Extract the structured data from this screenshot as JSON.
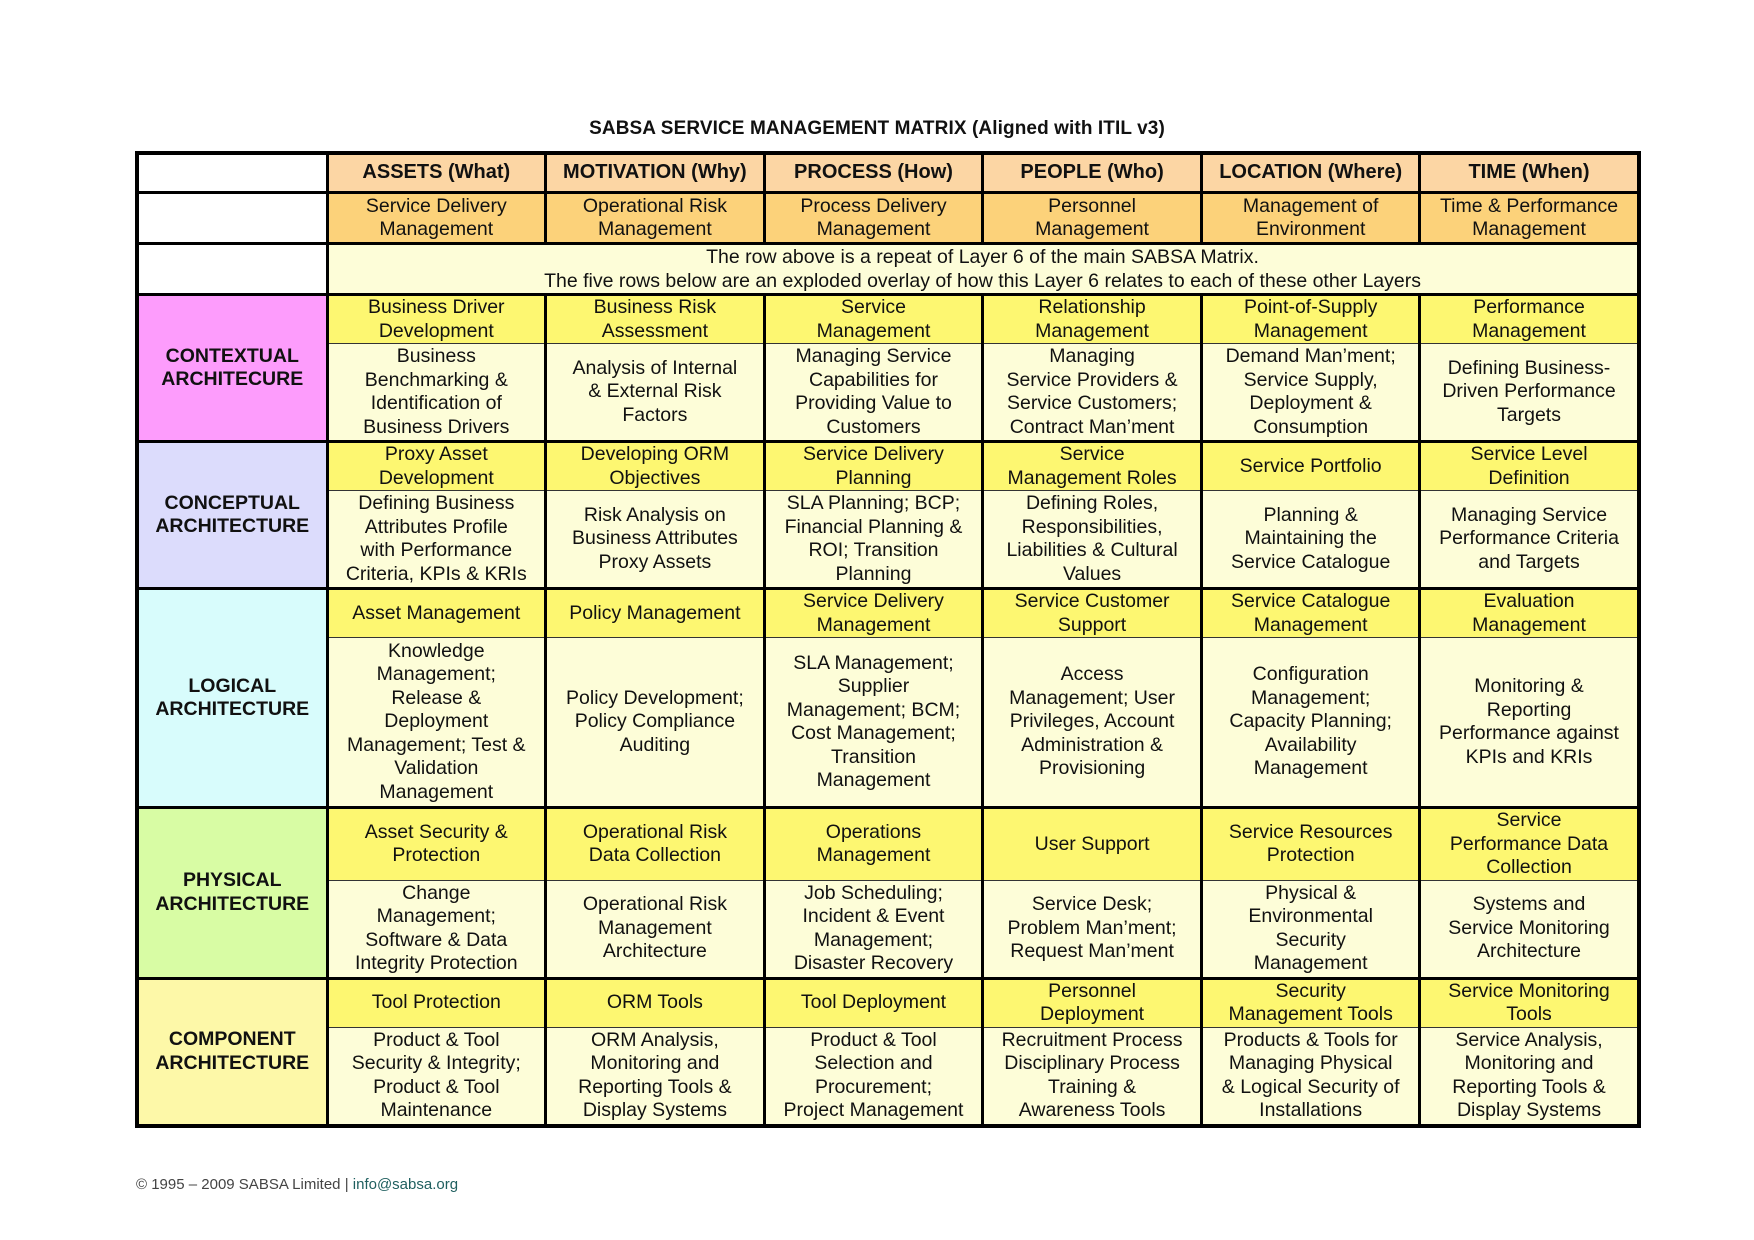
{
  "title": "SABSA SERVICE MANAGEMENT MATRIX (Aligned with ITIL v3)",
  "columns": [
    {
      "header": "ASSETS (What)",
      "layer6": [
        "Service Delivery",
        "Management"
      ]
    },
    {
      "header": "MOTIVATION (Why)",
      "layer6": [
        "Operational Risk",
        "Management"
      ]
    },
    {
      "header": "PROCESS (How)",
      "layer6": [
        "Process Delivery",
        "Management"
      ]
    },
    {
      "header": "PEOPLE (Who)",
      "layer6": [
        "Personnel",
        "Management"
      ]
    },
    {
      "header": "LOCATION (Where)",
      "layer6": [
        "Management of",
        "Environment"
      ]
    },
    {
      "header": "TIME (When)",
      "layer6": [
        "Time & Performance",
        "Management"
      ]
    }
  ],
  "note": [
    "The row above is a repeat of Layer 6 of the main SABSA Matrix.",
    "The five rows below are an exploded overlay of how this Layer 6 relates to each of these other Layers"
  ],
  "layers": [
    {
      "name": [
        "CONTEXTUAL",
        "ARCHITECURE"
      ],
      "color": "#fd9cfc",
      "cells": [
        {
          "title": [
            "Business Driver",
            "Development"
          ],
          "body": [
            "Business",
            "Benchmarking &",
            "Identification of",
            "Business Drivers"
          ]
        },
        {
          "title": [
            "Business Risk",
            "Assessment"
          ],
          "body": [
            "Analysis of Internal",
            "& External Risk",
            "Factors"
          ]
        },
        {
          "title": [
            "Service",
            "Management"
          ],
          "body": [
            "Managing Service",
            "Capabilities for",
            "Providing Value to",
            "Customers"
          ]
        },
        {
          "title": [
            "Relationship",
            "Management"
          ],
          "body": [
            "Managing",
            "Service Providers &",
            "Service Customers;",
            "Contract Man’ment"
          ]
        },
        {
          "title": [
            "Point-of-Supply",
            "Management"
          ],
          "body": [
            "Demand Man’ment;",
            "Service Supply,",
            "Deployment &",
            "Consumption"
          ]
        },
        {
          "title": [
            "Performance",
            "Management"
          ],
          "body": [
            "Defining Business-",
            "Driven Performance",
            "Targets"
          ]
        }
      ]
    },
    {
      "name": [
        "CONCEPTUAL",
        "ARCHITECTURE"
      ],
      "color": "#dcdcfc",
      "cells": [
        {
          "title": [
            "Proxy Asset",
            "Development"
          ],
          "body": [
            "Defining Business",
            "Attributes Profile",
            "with Performance",
            "Criteria, KPIs & KRIs"
          ]
        },
        {
          "title": [
            "Developing ORM",
            "Objectives"
          ],
          "body": [
            "Risk Analysis on",
            "Business Attributes",
            "Proxy Assets"
          ]
        },
        {
          "title": [
            "Service Delivery",
            "Planning"
          ],
          "body": [
            "SLA Planning; BCP;",
            "Financial Planning &",
            "ROI; Transition",
            "Planning"
          ]
        },
        {
          "title": [
            "Service",
            "Management Roles"
          ],
          "body": [
            "Defining Roles,",
            "Responsibilities,",
            "Liabilities & Cultural",
            "Values"
          ]
        },
        {
          "title": [
            "Service Portfolio"
          ],
          "body": [
            "Planning &",
            "Maintaining the",
            "Service Catalogue"
          ]
        },
        {
          "title": [
            "Service Level",
            "Definition"
          ],
          "body": [
            "Managing Service",
            "Performance Criteria",
            "and Targets"
          ]
        }
      ]
    },
    {
      "name": [
        "LOGICAL",
        "ARCHITECTURE"
      ],
      "color": "#d8fcfc",
      "cells": [
        {
          "title": [
            "Asset Management"
          ],
          "body": [
            "Knowledge",
            "Management;",
            "Release &",
            "Deployment",
            "Management; Test &",
            "Validation",
            "Management"
          ]
        },
        {
          "title": [
            "Policy Management"
          ],
          "body": [
            "Policy Development;",
            "Policy Compliance",
            "Auditing"
          ]
        },
        {
          "title": [
            "Service Delivery",
            "Management"
          ],
          "body": [
            "SLA Management;",
            "Supplier",
            "Management; BCM;",
            "Cost Management;",
            "Transition",
            "Management"
          ]
        },
        {
          "title": [
            "Service Customer",
            "Support"
          ],
          "body": [
            "Access",
            "Management; User",
            "Privileges, Account",
            "Administration &",
            "Provisioning"
          ]
        },
        {
          "title": [
            "Service Catalogue",
            "Management"
          ],
          "body": [
            "Configuration",
            "Management;",
            "Capacity Planning;",
            "Availability",
            "Management"
          ]
        },
        {
          "title": [
            "Evaluation",
            "Management"
          ],
          "body": [
            "Monitoring &",
            "Reporting",
            "Performance against",
            "KPIs and KRIs"
          ]
        }
      ]
    },
    {
      "name": [
        "PHYSICAL",
        "ARCHITECTURE"
      ],
      "color": "#d8fca4",
      "cells": [
        {
          "title": [
            "Asset Security &",
            "Protection"
          ],
          "body": [
            "Change",
            "Management;",
            "Software & Data",
            "Integrity Protection"
          ]
        },
        {
          "title": [
            "Operational Risk",
            "Data Collection"
          ],
          "body": [
            "Operational Risk",
            "Management",
            "Architecture"
          ]
        },
        {
          "title": [
            "Operations",
            "Management"
          ],
          "body": [
            "Job Scheduling;",
            "Incident & Event",
            "Management;",
            "Disaster Recovery"
          ]
        },
        {
          "title": [
            "User Support"
          ],
          "body": [
            "Service Desk;",
            "Problem Man’ment;",
            "Request Man’ment"
          ]
        },
        {
          "title": [
            "Service Resources",
            "Protection"
          ],
          "body": [
            "Physical &",
            "Environmental",
            "Security",
            "Management"
          ]
        },
        {
          "title": [
            "Service",
            "Performance Data",
            "Collection"
          ],
          "body": [
            "Systems and",
            "Service Monitoring",
            "Architecture"
          ]
        }
      ]
    },
    {
      "name": [
        "COMPONENT",
        "ARCHITECTURE"
      ],
      "color": "#fdf8a8",
      "cells": [
        {
          "title": [
            "Tool Protection"
          ],
          "body": [
            "Product & Tool",
            "Security & Integrity;",
            "Product & Tool",
            "Maintenance"
          ]
        },
        {
          "title": [
            "ORM Tools"
          ],
          "body": [
            "ORM Analysis,",
            "Monitoring and",
            "Reporting Tools &",
            "Display Systems"
          ]
        },
        {
          "title": [
            "Tool Deployment"
          ],
          "body": [
            "Product & Tool",
            "Selection and",
            "Procurement;",
            "Project Management"
          ]
        },
        {
          "title": [
            "Personnel",
            "Deployment"
          ],
          "body": [
            "Recruitment Process",
            "Disciplinary Process",
            "Training &",
            "Awareness Tools"
          ]
        },
        {
          "title": [
            "Security",
            "Management Tools"
          ],
          "body": [
            "Products & Tools for",
            "Managing Physical",
            "& Logical Security of",
            "Installations"
          ]
        },
        {
          "title": [
            "Service Monitoring",
            "Tools"
          ],
          "body": [
            "Service Analysis,",
            "Monitoring and",
            "Reporting Tools &",
            "Display Systems"
          ]
        }
      ]
    }
  ],
  "colors": {
    "header_bg": "#fcd6a4",
    "layer6_bg": "#fcd27a",
    "subtitle_bg": "#fdf771",
    "body_bg": "#fdfdd8"
  },
  "footer": {
    "copyright": "© 1995 – 2009 SABSA Limited | ",
    "email": "info@sabsa.org"
  }
}
